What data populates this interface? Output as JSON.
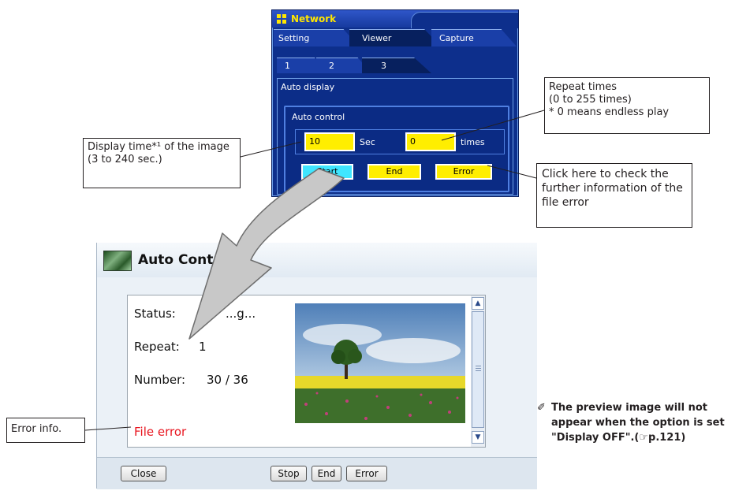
{
  "network_panel": {
    "title": "Network",
    "tabs": [
      {
        "label": "Setting",
        "active": false
      },
      {
        "label": "Viewer",
        "active": true
      },
      {
        "label": "Capture",
        "active": false
      }
    ],
    "subtabs": [
      {
        "label": "1",
        "active": false
      },
      {
        "label": "2",
        "active": false
      },
      {
        "label": "3",
        "active": true
      }
    ],
    "section_label": "Auto display",
    "group_label": "Auto control",
    "display_time_value": "10",
    "sec_label": "Sec",
    "repeat_value": "0",
    "times_label": "times",
    "buttons": {
      "start": "Start",
      "end": "End",
      "error": "Error"
    }
  },
  "callouts": {
    "display_time": "Display time*¹ of the image (3 to 240 sec.)",
    "repeat_times": {
      "line1": "Repeat times",
      "line2": "(0 to 255 times)",
      "line3": "* 0 means endless play"
    },
    "error_click": "Click here to check the further information of the file error",
    "error_info": "Error info."
  },
  "auto_control_window": {
    "title": "Auto Control",
    "status_label": "Status:",
    "status_value": "...g...",
    "repeat_label": "Repeat:",
    "repeat_value": "1",
    "number_label": "Number:",
    "number_value": "30 / 36",
    "error_text": "File error",
    "buttons": {
      "close": "Close",
      "stop": "Stop",
      "end": "End",
      "error": "Error"
    }
  },
  "note": {
    "icon": "pencil-icon",
    "text": "The preview image will not appear when the option is set \"Display OFF\".(☞p.121)"
  },
  "colors": {
    "panel_blue": "#0d2f8c",
    "field_yellow": "#ffee00",
    "start_cyan": "#3fe6ff",
    "error_red": "#e8141e",
    "arrow_gray": "#c8c8c8"
  }
}
